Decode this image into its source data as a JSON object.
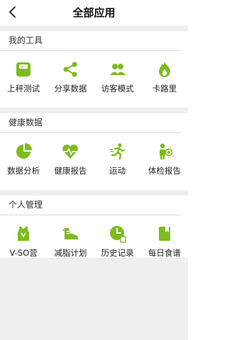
{
  "header": {
    "title": "全部应用",
    "back_icon": "chevron-left-icon"
  },
  "colors": {
    "accent": "#7dbb1f",
    "divider": "#efefef"
  },
  "sections": [
    {
      "title": "我的工具",
      "items": [
        {
          "label": "上秤测试",
          "icon": "scale-icon"
        },
        {
          "label": "分享数据",
          "icon": "share-icon"
        },
        {
          "label": "访客模式",
          "icon": "guest-users-icon"
        },
        {
          "label": "卡路里",
          "icon": "flame-icon"
        }
      ]
    },
    {
      "title": "健康数据",
      "items": [
        {
          "label": "数据分析",
          "icon": "pie-chart-icon"
        },
        {
          "label": "健康报告",
          "icon": "heart-pulse-icon"
        },
        {
          "label": "运动",
          "icon": "running-icon"
        },
        {
          "label": "体检报告",
          "icon": "person-plus-icon"
        }
      ]
    },
    {
      "title": "个人管理",
      "items": [
        {
          "label": "V-SO营",
          "icon": "vest-icon"
        },
        {
          "label": "减脂计划",
          "icon": "shoe-icon"
        },
        {
          "label": "历史记录",
          "icon": "clock-icon"
        },
        {
          "label": "每日食谱",
          "icon": "recipe-book-icon"
        }
      ]
    }
  ]
}
